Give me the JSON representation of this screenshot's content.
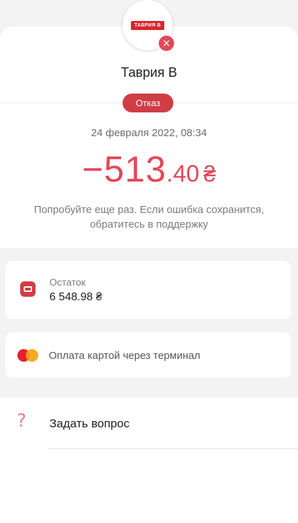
{
  "header": {
    "logo_text": "ТАВРИЯ В",
    "status_symbol": "×"
  },
  "transaction": {
    "merchant": "Таврия В",
    "status_badge": "Отказ",
    "datetime": "24 февраля 2022, 08:34",
    "amount_sign": "−",
    "amount_main": "513",
    "amount_decimal": ".40",
    "currency": "₴",
    "message": "Попробуйте еще раз. Если ошибка сохранится, обратитесь в поддержку",
    "amount_color": "#e44759"
  },
  "balance": {
    "label": "Остаток",
    "value": "6 548.98 ₴",
    "icon": "wallet-icon"
  },
  "payment_method": {
    "text": "Оплата картой через терминал",
    "icon": "mastercard-icon"
  },
  "help": {
    "label": "Задать вопрос",
    "icon_glyph": "?",
    "icon": "question-icon"
  },
  "colors": {
    "accent": "#d03d45",
    "background": "#f3f3f3"
  }
}
